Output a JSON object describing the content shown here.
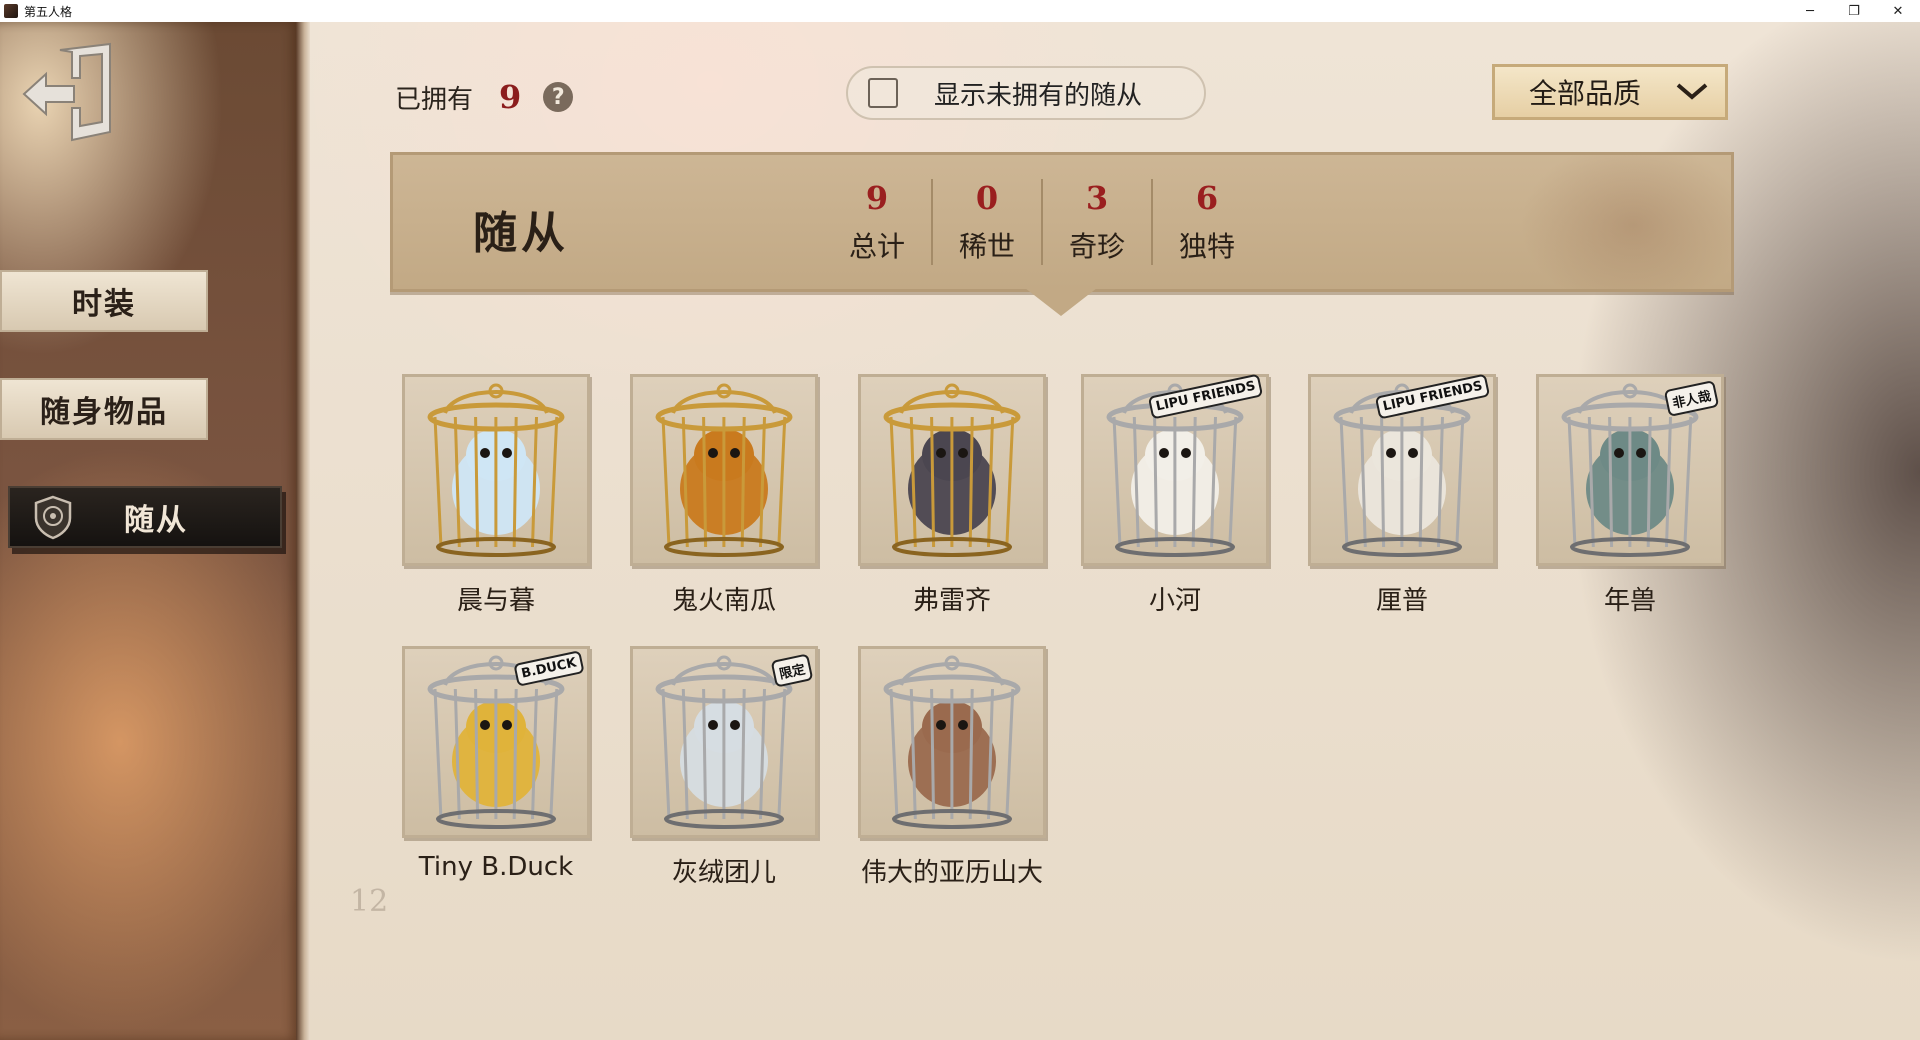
{
  "window": {
    "title": "第五人格",
    "controls": {
      "minimize": "─",
      "restore": "❐",
      "close": "✕"
    }
  },
  "sidebar": {
    "items": [
      {
        "label": "时装"
      },
      {
        "label": "随身物品"
      },
      {
        "label": "随从",
        "active": true
      }
    ]
  },
  "header": {
    "owned_label": "已拥有",
    "owned_count": "9",
    "help": "?",
    "show_unowned_label": "显示未拥有的随从",
    "quality_select": "全部品质"
  },
  "banner": {
    "title": "随从",
    "stats": [
      {
        "value": "9",
        "label": "总计"
      },
      {
        "value": "0",
        "label": "稀世"
      },
      {
        "value": "3",
        "label": "奇珍"
      },
      {
        "value": "6",
        "label": "独特"
      }
    ]
  },
  "companions": [
    {
      "name": "晨与暮",
      "cage": "gold",
      "color": "#cfe6f5"
    },
    {
      "name": "鬼火南瓜",
      "cage": "gold",
      "color": "#c97a1e"
    },
    {
      "name": "弗雷齐",
      "cage": "gold",
      "color": "#4b4650"
    },
    {
      "name": "小河",
      "cage": "silver",
      "color": "#f2efe8",
      "badge": "LIPU FRIENDS"
    },
    {
      "name": "厘普",
      "cage": "silver",
      "color": "#ebe6dc",
      "badge": "LIPU FRIENDS"
    },
    {
      "name": "年兽",
      "cage": "silver",
      "color": "#6e8a86",
      "badge": "非人哉"
    },
    {
      "name": "Tiny B.Duck",
      "cage": "silver",
      "color": "#e0b33a",
      "badge": "B.DUCK"
    },
    {
      "name": "灰绒团儿",
      "cage": "silver",
      "color": "#d6dde2",
      "badge": "限定"
    },
    {
      "name": "伟大的亚历山大",
      "cage": "silver",
      "color": "#9a6a4e"
    }
  ],
  "background_mark": "12"
}
